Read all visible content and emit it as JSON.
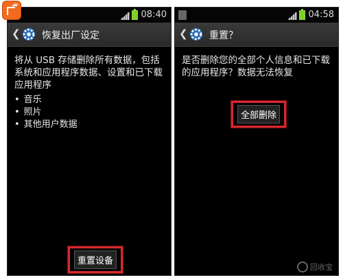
{
  "left_screen": {
    "status_time": "08:40",
    "title": "恢复出厂设定",
    "description": "将从 USB 存储删除所有数据，包括系统和应用程序数据、设置和已下载应用程序",
    "items": [
      "音乐",
      "照片",
      "其他用户数据"
    ],
    "button_label": "重置设备"
  },
  "right_screen": {
    "status_time": "04:58",
    "title": "重置？",
    "description": "是否删除您的全部个人信息和已下载的应用程序？数据无法恢复",
    "button_label": "全部删除"
  },
  "icons": {
    "back": "chevron-left-icon",
    "settings": "gear-icon",
    "signal": "signal-icon",
    "battery": "battery-icon",
    "notification": "notification-icon"
  },
  "colors": {
    "highlight": "#d7282f",
    "battery": "#7ed321",
    "corner_badge": "#f36b1f"
  },
  "watermark": "回收宝"
}
